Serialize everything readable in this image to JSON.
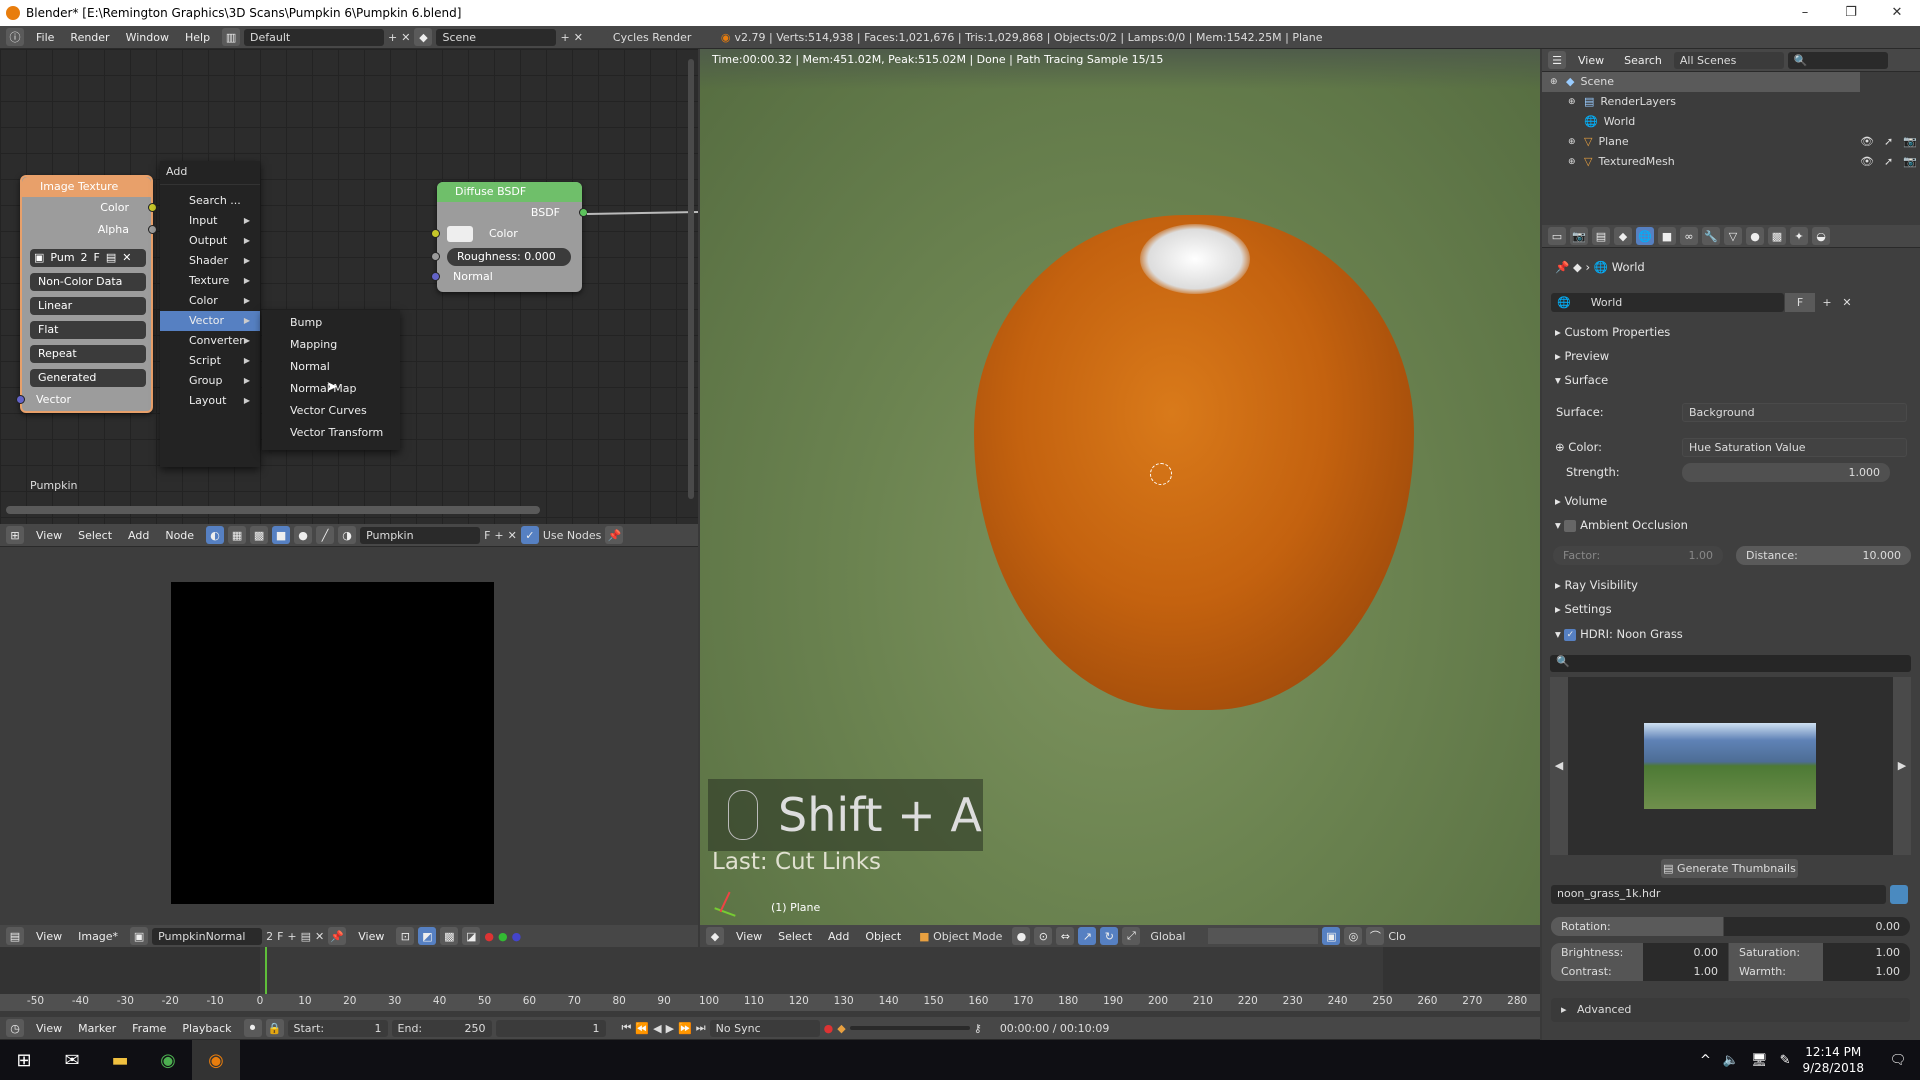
{
  "window": {
    "title": "Blender* [E:\\Remington Graphics\\3D Scans\\Pumpkin 6\\Pumpkin 6.blend]",
    "minimize": "–",
    "maximize": "❐",
    "close": "✕"
  },
  "info_header": {
    "menus": [
      "File",
      "Render",
      "Window",
      "Help"
    ],
    "layout": "Default",
    "scene": "Scene",
    "engine": "Cycles Render",
    "stats": "v2.79 | Verts:514,938 | Faces:1,021,676 | Tris:1,029,868 | Objects:0/2 | Lamps:0/0 | Mem:1542.25M | Plane"
  },
  "node_editor": {
    "image_texture": {
      "title": "Image Texture",
      "outputs": [
        "Color",
        "Alpha"
      ],
      "image": "Pum",
      "users": "2",
      "fake": "F",
      "color_space": "Non-Color Data",
      "interpolation": "Linear",
      "projection": "Flat",
      "extension": "Repeat",
      "vector_src": "Generated",
      "input": "Vector"
    },
    "diffuse": {
      "title": "Diffuse BSDF",
      "output": "BSDF",
      "color_label": "Color",
      "roughness": "Roughness:",
      "roughness_value": "0.000",
      "normal": "Normal"
    },
    "add_menu": {
      "title": "Add",
      "items": [
        "Search ...",
        "Input",
        "Output",
        "Shader",
        "Texture",
        "Color",
        "Vector",
        "Converter",
        "Script",
        "Group",
        "Layout"
      ],
      "highlighted": "Vector"
    },
    "vector_submenu": [
      "Bump",
      "Mapping",
      "Normal",
      "Normal Map",
      "Vector Curves",
      "Vector Transform"
    ],
    "material_label": "Pumpkin",
    "header": {
      "menus": [
        "View",
        "Select",
        "Add",
        "Node"
      ],
      "material": "Pumpkin",
      "fake": "F",
      "use_nodes": "Use Nodes",
      "use_nodes_checked": true
    }
  },
  "image_editor": {
    "header": {
      "menus": [
        "View",
        "Image*"
      ],
      "image": "PumpkinNormal",
      "users": "2",
      "fake": "F",
      "view": "View"
    }
  },
  "viewport": {
    "render_status": "Time:00:00.32 | Mem:451.02M, Peak:515.02M | Done | Path Tracing Sample 15/15",
    "key_overlay": "Shift + A",
    "last_op": "Last: Cut Links",
    "object_label": "(1) Plane",
    "header": {
      "menus": [
        "View",
        "Select",
        "Add",
        "Object"
      ],
      "mode": "Object Mode",
      "orientation": "Global",
      "clip": "Clo"
    }
  },
  "outliner": {
    "header": {
      "view": "View",
      "search": "Search",
      "filter": "All Scenes"
    },
    "items": [
      {
        "label": "Scene",
        "level": 0,
        "icon": "scene-icon"
      },
      {
        "label": "RenderLayers",
        "level": 1,
        "icon": "renderlayers-icon"
      },
      {
        "label": "World",
        "level": 1,
        "icon": "world-icon"
      },
      {
        "label": "Plane",
        "level": 1,
        "icon": "mesh-icon"
      },
      {
        "label": "TexturedMesh",
        "level": 1,
        "icon": "mesh-icon"
      }
    ]
  },
  "properties": {
    "breadcrumb": "World",
    "datablock": "World",
    "fake": "F",
    "panels": {
      "custom": "Custom Properties",
      "preview": "Preview",
      "surface": "Surface",
      "volume": "Volume",
      "ao": "Ambient Occlusion",
      "ray": "Ray Visibility",
      "settings": "Settings",
      "hdri": "HDRI: Noon Grass",
      "advanced": "Advanced"
    },
    "surface_label": "Surface:",
    "surface_value": "Background",
    "color_label": "Color:",
    "color_value": "Hue Saturation Value",
    "strength_label": "Strength:",
    "strength_value": "1.000",
    "factor_label": "Factor:",
    "factor_value": "1.00",
    "distance_label": "Distance:",
    "distance_value": "10.000",
    "hdri_enabled": true,
    "ao_enabled": false,
    "generate_thumbnails": "Generate Thumbnails",
    "hdri_file": "noon_grass_1k.hdr",
    "rotation_label": "Rotation:",
    "rotation_value": "0.00",
    "brightness_label": "Brightness:",
    "brightness_value": "0.00",
    "saturation_label": "Saturation:",
    "saturation_value": "1.00",
    "contrast_label": "Contrast:",
    "contrast_value": "1.00",
    "warmth_label": "Warmth:",
    "warmth_value": "1.00"
  },
  "timeline": {
    "ticks": [
      -50,
      -40,
      -30,
      -20,
      -10,
      0,
      10,
      20,
      30,
      40,
      50,
      60,
      70,
      80,
      90,
      100,
      110,
      120,
      130,
      140,
      150,
      160,
      170,
      180,
      190,
      200,
      210,
      220,
      230,
      240,
      250,
      260,
      270,
      280
    ],
    "current_frame": 1,
    "menus": [
      "View",
      "Marker",
      "Frame",
      "Playback"
    ],
    "start_label": "Start:",
    "start": "1",
    "end_label": "End:",
    "end": "250",
    "frame": "1",
    "sync": "No Sync",
    "time": "00:00:00 / 00:10:09"
  },
  "taskbar": {
    "time": "12:14 PM",
    "date": "9/28/2018"
  },
  "colors": {
    "accent": "#5680c2",
    "pumpkin": "#c4620f",
    "node_texture_header": "#e8a06a",
    "node_shader_header": "#6fbf6a"
  }
}
